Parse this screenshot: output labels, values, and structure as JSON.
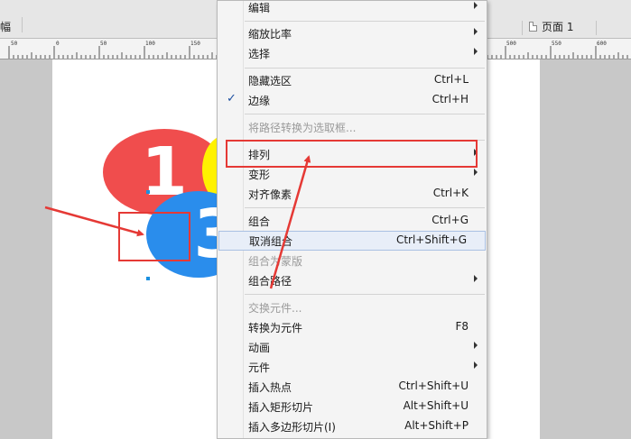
{
  "tabbar": {
    "left_tab": "幅",
    "page_label": "页面 1"
  },
  "ruler": {
    "labels": [
      "50",
      "0",
      "50",
      "100",
      "150",
      "200",
      "500",
      "550",
      "600"
    ]
  },
  "canvas": {
    "shape_red_label": "1",
    "shape_blue_label": "3"
  },
  "menu": {
    "items": [
      {
        "label": "编辑",
        "shortcut": "",
        "submenu": true
      },
      {
        "label": "缩放比率",
        "shortcut": "",
        "submenu": true
      },
      {
        "label": "选择",
        "shortcut": "",
        "submenu": true
      },
      {
        "label": "隐藏选区",
        "shortcut": "Ctrl+L",
        "submenu": false
      },
      {
        "label": "边缘",
        "shortcut": "Ctrl+H",
        "submenu": false,
        "checked": true
      },
      {
        "label": "将路径转换为选取框...",
        "shortcut": "",
        "submenu": false,
        "disabled": true
      },
      {
        "label": "排列",
        "shortcut": "",
        "submenu": true
      },
      {
        "label": "变形",
        "shortcut": "",
        "submenu": true
      },
      {
        "label": "对齐像素",
        "shortcut": "Ctrl+K",
        "submenu": false
      },
      {
        "label": "组合",
        "shortcut": "Ctrl+G",
        "submenu": false
      },
      {
        "label": "取消组合",
        "shortcut": "Ctrl+Shift+G",
        "submenu": false,
        "highlighted": true
      },
      {
        "label": "组合为蒙版",
        "shortcut": "",
        "submenu": false,
        "disabled": true
      },
      {
        "label": "组合路径",
        "shortcut": "",
        "submenu": true
      },
      {
        "label": "交换元件...",
        "shortcut": "",
        "submenu": false,
        "disabled": true
      },
      {
        "label": "转换为元件",
        "shortcut": "F8",
        "submenu": false
      },
      {
        "label": "动画",
        "shortcut": "",
        "submenu": true
      },
      {
        "label": "元件",
        "shortcut": "",
        "submenu": true
      },
      {
        "label": "插入热点",
        "shortcut": "Ctrl+Shift+U",
        "submenu": false
      },
      {
        "label": "插入矩形切片",
        "shortcut": "Alt+Shift+U",
        "submenu": false
      },
      {
        "label": "插入多边形切片(I)",
        "shortcut": "Alt+Shift+P",
        "submenu": false
      }
    ]
  },
  "colors": {
    "annotation": "#e53935",
    "shape_red": "#f04d4d",
    "shape_yellow": "#fff200",
    "shape_blue": "#2a8dec"
  }
}
